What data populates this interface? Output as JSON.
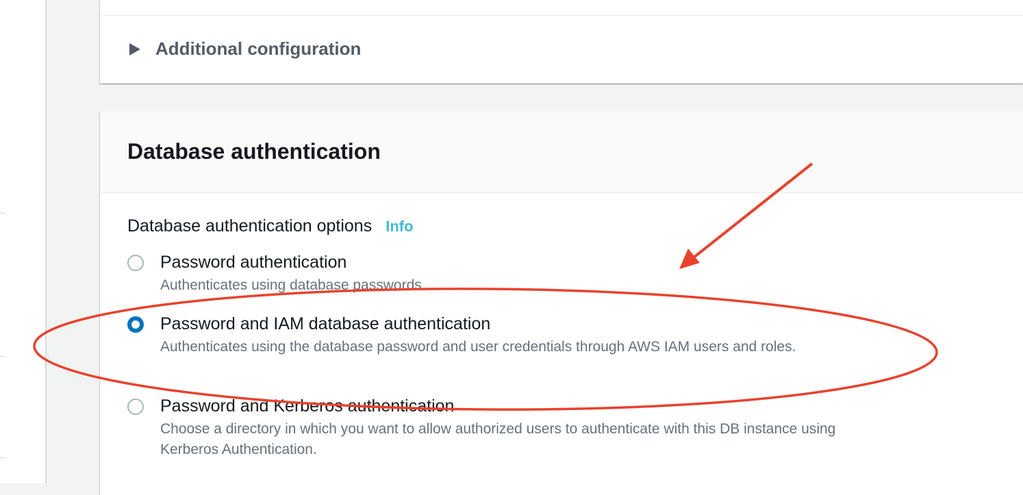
{
  "additional_config": {
    "label": "Additional configuration"
  },
  "auth": {
    "title": "Database authentication",
    "options_label": "Database authentication options",
    "info_link": "Info",
    "options": [
      {
        "title": "Password authentication",
        "description": "Authenticates using database passwords.",
        "selected": false
      },
      {
        "title": "Password and IAM database authentication",
        "description": "Authenticates using the database password and user credentials through AWS IAM users and roles.",
        "selected": true
      },
      {
        "title": "Password and Kerberos authentication",
        "description": "Choose a directory in which you want to allow authorized users to authenticate with this DB instance using Kerberos Authentication.",
        "selected": false
      }
    ]
  },
  "annotation": {
    "color": "#e8422c"
  },
  "colors": {
    "radio_selected": "#0073bb",
    "info_link": "#44b9d6"
  }
}
